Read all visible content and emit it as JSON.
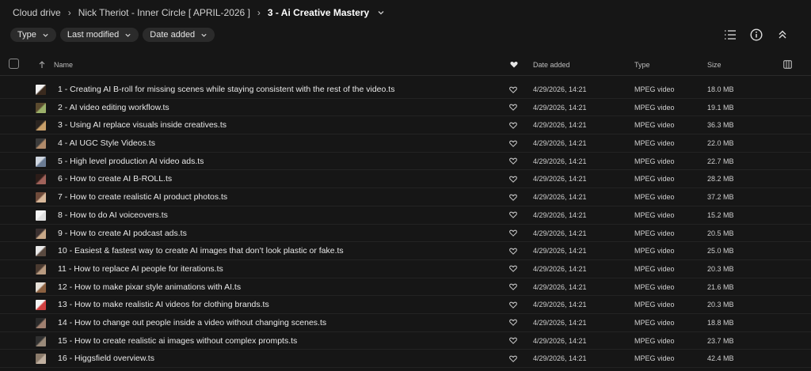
{
  "breadcrumb": {
    "items": [
      "Cloud drive",
      "Nick Theriot - Inner Circle [ APRIL-2026 ]",
      "3 - Ai Creative Mastery"
    ]
  },
  "filters": [
    "Type",
    "Last modified",
    "Date added"
  ],
  "columns": {
    "name": "Name",
    "date_added": "Date added",
    "type": "Type",
    "size": "Size"
  },
  "files": [
    {
      "name": "1 - Creating AI B-roll for missing scenes while staying consistent with the rest of the video.ts",
      "date": "4/29/2026, 14:21",
      "type": "MPEG video",
      "size": "18.0 MB",
      "thumb": [
        "#f2f2f2",
        "#3a2a1e"
      ]
    },
    {
      "name": "2 - AI video editing workflow.ts",
      "date": "4/29/2026, 14:21",
      "type": "MPEG video",
      "size": "19.1 MB",
      "thumb": [
        "#5a4a2e",
        "#9bb06a"
      ]
    },
    {
      "name": "3 - Using AI replace visuals inside creatives.ts",
      "date": "4/29/2026, 14:21",
      "type": "MPEG video",
      "size": "36.3 MB",
      "thumb": [
        "#2a2420",
        "#c9a06a"
      ]
    },
    {
      "name": "4 - AI UGC Style Videos.ts",
      "date": "4/29/2026, 14:21",
      "type": "MPEG video",
      "size": "22.0 MB",
      "thumb": [
        "#3b3b3b",
        "#b08a6a"
      ]
    },
    {
      "name": "5 - High level production AI video ads.ts",
      "date": "4/29/2026, 14:21",
      "type": "MPEG video",
      "size": "22.7 MB",
      "thumb": [
        "#cfd6e0",
        "#6b7c94"
      ]
    },
    {
      "name": "6 - How to create AI B-ROLL.ts",
      "date": "4/29/2026, 14:21",
      "type": "MPEG video",
      "size": "28.2 MB",
      "thumb": [
        "#2c1c18",
        "#a0625a"
      ]
    },
    {
      "name": "7 - How to create realistic AI product photos.ts",
      "date": "4/29/2026, 14:21",
      "type": "MPEG video",
      "size": "37.2 MB",
      "thumb": [
        "#6e4a3a",
        "#d8b89a"
      ]
    },
    {
      "name": "8 - How to do AI voiceovers.ts",
      "date": "4/29/2026, 14:21",
      "type": "MPEG video",
      "size": "15.2 MB",
      "thumb": [
        "#f4f4f4",
        "#e0e0e0"
      ]
    },
    {
      "name": "9 - How to create AI podcast ads.ts",
      "date": "4/29/2026, 14:21",
      "type": "MPEG video",
      "size": "20.5 MB",
      "thumb": [
        "#3a3030",
        "#c8a888"
      ]
    },
    {
      "name": "10 - Easiest & fastest way to create AI images that don’t look plastic or fake.ts",
      "date": "4/29/2026, 14:21",
      "type": "MPEG video",
      "size": "25.0 MB",
      "thumb": [
        "#e8e8e8",
        "#5a4a40"
      ]
    },
    {
      "name": "11 - How to replace AI people for iterations.ts",
      "date": "4/29/2026, 14:21",
      "type": "MPEG video",
      "size": "20.3 MB",
      "thumb": [
        "#4a3a30",
        "#b89a80"
      ]
    },
    {
      "name": "12 - How to make pixar style animations with AI.ts",
      "date": "4/29/2026, 14:21",
      "type": "MPEG video",
      "size": "21.6 MB",
      "thumb": [
        "#e6e0d8",
        "#8a6040"
      ]
    },
    {
      "name": "13 - How to make realistic AI videos for clothing brands.ts",
      "date": "4/29/2026, 14:21",
      "type": "MPEG video",
      "size": "20.3 MB",
      "thumb": [
        "#f4f4f4",
        "#d04040"
      ]
    },
    {
      "name": "14 - How to change out people inside a video without changing scenes.ts",
      "date": "4/29/2026, 14:21",
      "type": "MPEG video",
      "size": "18.8 MB",
      "thumb": [
        "#2a2a2a",
        "#a08070"
      ]
    },
    {
      "name": "15 - How to create realistic ai images without complex prompts.ts",
      "date": "4/29/2026, 14:21",
      "type": "MPEG video",
      "size": "23.7 MB",
      "thumb": [
        "#303030",
        "#9a8a7a"
      ]
    },
    {
      "name": "16 - Higgsfield overview.ts",
      "date": "4/29/2026, 14:21",
      "type": "MPEG video",
      "size": "42.4 MB",
      "thumb": [
        "#8a7a6a",
        "#c0b0a0"
      ]
    }
  ]
}
